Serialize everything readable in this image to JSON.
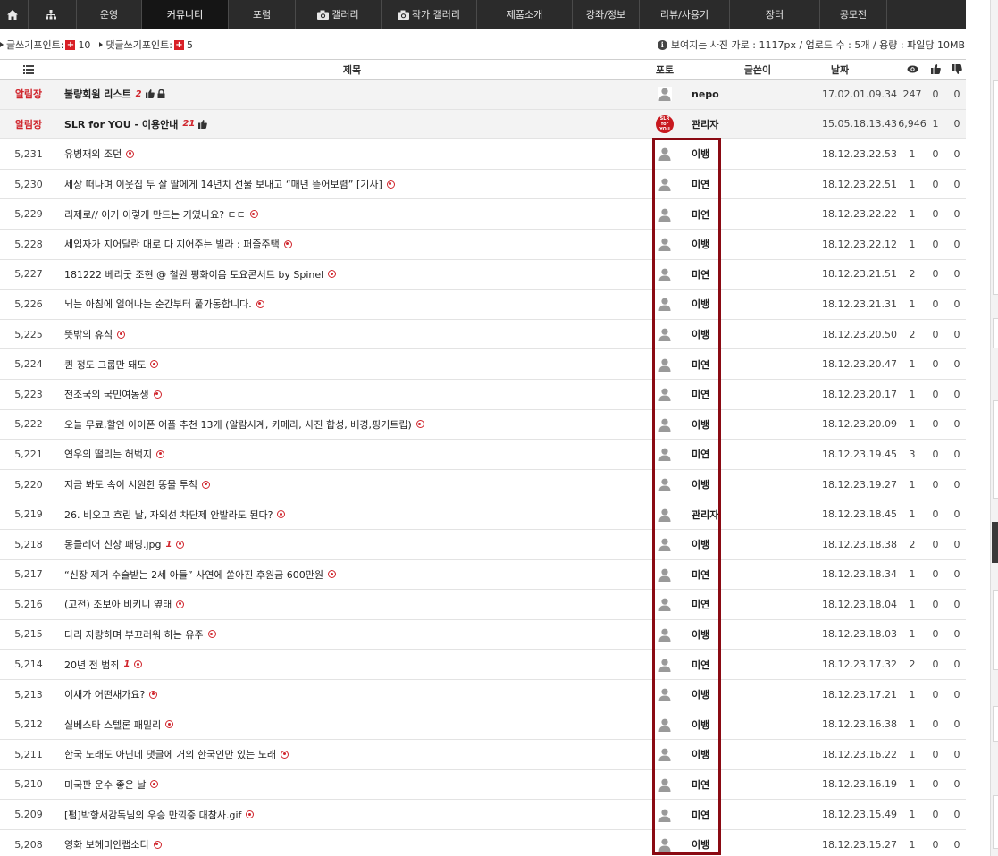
{
  "nav": {
    "items": [
      {
        "label": "",
        "icon": "home-icon"
      },
      {
        "label": "",
        "icon": "sitemap-icon"
      },
      {
        "label": "운영"
      },
      {
        "label": "커뮤니티",
        "active": true
      },
      {
        "label": "포럼"
      },
      {
        "label": "갤러리",
        "icon": "camera-icon"
      },
      {
        "label": "작가 갤러리",
        "icon": "camera-icon"
      },
      {
        "label": "제품소개"
      },
      {
        "label": "강좌/정보"
      },
      {
        "label": "리뷰/사용기"
      },
      {
        "label": "장터"
      },
      {
        "label": "공모전"
      }
    ]
  },
  "info": {
    "post_points_label": "글쓰기포인트:",
    "post_points": "10",
    "comment_points_label": "댓글쓰기포인트:",
    "comment_points": "5",
    "upload_info": "보여지는 사진 가로 : 1117px / 업로드 수 : 5개 / 용량 : 파일당 10MB"
  },
  "columns": {
    "title": "제목",
    "photo": "포토",
    "author": "글쓴이",
    "date": "날짜"
  },
  "notices": [
    {
      "label": "알림장",
      "title": "불량회원 리스트",
      "comments": "2",
      "author": "nepo",
      "date": "17.02.01.09.34",
      "views": "247",
      "up": "0",
      "down": "0",
      "avatar": "default",
      "lock": true
    },
    {
      "label": "알림장",
      "title": "SLR for YOU - 이용안내",
      "comments": "21",
      "author": "관리자",
      "date": "15.05.18.13.43",
      "views": "6,946",
      "up": "1",
      "down": "0",
      "avatar": "slr",
      "slr_text": "SLR for YOU"
    }
  ],
  "posts": [
    {
      "num": "5,231",
      "title": "유병재의 조던",
      "comments": "",
      "author": "이뱅",
      "date": "18.12.23.22.53",
      "views": "1",
      "up": "0",
      "down": "0"
    },
    {
      "num": "5,230",
      "title": "세상 떠나며 이웃집 두 살 딸에게 14년치 선물 보내고 “매년 뜯어보렴” [기사]",
      "comments": "",
      "author": "미연",
      "date": "18.12.23.22.51",
      "views": "1",
      "up": "0",
      "down": "0"
    },
    {
      "num": "5,229",
      "title": "리제로// 이거 이렇게 만드는 거였나요? ㄷㄷ",
      "comments": "",
      "author": "미연",
      "date": "18.12.23.22.22",
      "views": "1",
      "up": "0",
      "down": "0"
    },
    {
      "num": "5,228",
      "title": "세입자가 지어달란 대로 다 지어주는 빌라 : 퍼즐주택",
      "comments": "",
      "author": "이뱅",
      "date": "18.12.23.22.12",
      "views": "1",
      "up": "0",
      "down": "0"
    },
    {
      "num": "5,227",
      "title": "181222 베리굿 조현 @ 철원 평화이음 토요콘서트 by Spinel",
      "comments": "",
      "author": "미연",
      "date": "18.12.23.21.51",
      "views": "2",
      "up": "0",
      "down": "0"
    },
    {
      "num": "5,226",
      "title": "뇌는 아침에 일어나는 순간부터 풀가동합니다.",
      "comments": "",
      "author": "이뱅",
      "date": "18.12.23.21.31",
      "views": "1",
      "up": "0",
      "down": "0"
    },
    {
      "num": "5,225",
      "title": "뜻밖의 휴식",
      "comments": "",
      "author": "이뱅",
      "date": "18.12.23.20.50",
      "views": "2",
      "up": "0",
      "down": "0"
    },
    {
      "num": "5,224",
      "title": "퀸 정도 그룹만 돼도",
      "comments": "",
      "author": "미연",
      "date": "18.12.23.20.47",
      "views": "1",
      "up": "0",
      "down": "0"
    },
    {
      "num": "5,223",
      "title": "천조국의 국민여동생",
      "comments": "",
      "author": "미연",
      "date": "18.12.23.20.17",
      "views": "1",
      "up": "0",
      "down": "0"
    },
    {
      "num": "5,222",
      "title": "오늘 무료,할인 아이폰 어플 추천 13개 (알람시계, 카메라, 사진 합성, 배경,핑거트립)",
      "comments": "",
      "author": "이뱅",
      "date": "18.12.23.20.09",
      "views": "1",
      "up": "0",
      "down": "0"
    },
    {
      "num": "5,221",
      "title": "연우의 떨리는 허벅지",
      "comments": "",
      "author": "미연",
      "date": "18.12.23.19.45",
      "views": "3",
      "up": "0",
      "down": "0"
    },
    {
      "num": "5,220",
      "title": "지금 봐도 속이 시원한 똥물 투척",
      "comments": "",
      "author": "이뱅",
      "date": "18.12.23.19.27",
      "views": "1",
      "up": "0",
      "down": "0"
    },
    {
      "num": "5,219",
      "title": "26. 비오고 흐린 날, 자외선 차단제 안발라도 된다?",
      "comments": "",
      "author": "관리자",
      "date": "18.12.23.18.45",
      "views": "1",
      "up": "0",
      "down": "0"
    },
    {
      "num": "5,218",
      "title": "몽클레어 신상 패딩.jpg",
      "comments": "1",
      "author": "이뱅",
      "date": "18.12.23.18.38",
      "views": "2",
      "up": "0",
      "down": "0"
    },
    {
      "num": "5,217",
      "title": "“신장 제거 수술받는 2세 아들” 사연에 쏟아진 후원금 600만원",
      "comments": "",
      "author": "미연",
      "date": "18.12.23.18.34",
      "views": "1",
      "up": "0",
      "down": "0"
    },
    {
      "num": "5,216",
      "title": "(고전) 조보아 비키니 옆태",
      "comments": "",
      "author": "미연",
      "date": "18.12.23.18.04",
      "views": "1",
      "up": "0",
      "down": "0"
    },
    {
      "num": "5,215",
      "title": "다리 자랑하며 부끄러워 하는 유주",
      "comments": "",
      "author": "이뱅",
      "date": "18.12.23.18.03",
      "views": "1",
      "up": "0",
      "down": "0"
    },
    {
      "num": "5,214",
      "title": "20년 전 범죄",
      "comments": "1",
      "author": "미연",
      "date": "18.12.23.17.32",
      "views": "2",
      "up": "0",
      "down": "0"
    },
    {
      "num": "5,213",
      "title": "이새가 어떤새가요?",
      "comments": "",
      "author": "이뱅",
      "date": "18.12.23.17.21",
      "views": "1",
      "up": "0",
      "down": "0"
    },
    {
      "num": "5,212",
      "title": "실베스타 스텔론 패밀리",
      "comments": "",
      "author": "이뱅",
      "date": "18.12.23.16.38",
      "views": "1",
      "up": "0",
      "down": "0"
    },
    {
      "num": "5,211",
      "title": "한국 노래도 아닌데 댓글에 거의 한국인만 있는 노래",
      "comments": "",
      "author": "이뱅",
      "date": "18.12.23.16.22",
      "views": "1",
      "up": "0",
      "down": "0"
    },
    {
      "num": "5,210",
      "title": "미국판 운수 좋은 날",
      "comments": "",
      "author": "미연",
      "date": "18.12.23.16.19",
      "views": "1",
      "up": "0",
      "down": "0"
    },
    {
      "num": "5,209",
      "title": "[펌]박항서감독님의 우승 만끽중 대참사.gif",
      "comments": "",
      "author": "미연",
      "date": "18.12.23.15.49",
      "views": "1",
      "up": "0",
      "down": "0"
    },
    {
      "num": "5,208",
      "title": "영화 보헤미안랩소디",
      "comments": "",
      "author": "이뱅",
      "date": "18.12.23.15.27",
      "views": "1",
      "up": "0",
      "down": "0"
    }
  ],
  "colors": {
    "nav_bg": "#2b2b2b",
    "accent_red": "#d0262d",
    "highlight_box": "#8a0a13"
  }
}
